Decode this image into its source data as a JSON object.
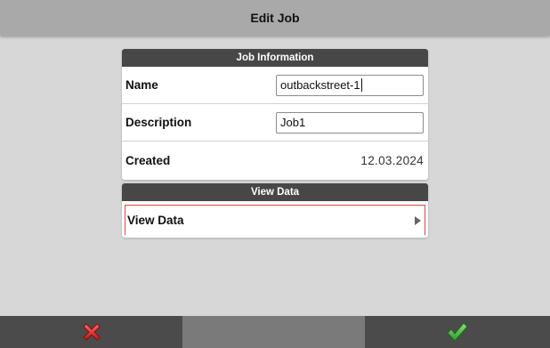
{
  "header": {
    "title": "Edit Job"
  },
  "job_information": {
    "section_title": "Job Information",
    "name_label": "Name",
    "name_value": "outbackstreet-1",
    "description_label": "Description",
    "description_value": "Job1",
    "created_label": "Created",
    "created_value": "12.03.2024"
  },
  "view_data": {
    "section_title": "View Data",
    "item_label": "View Data"
  },
  "bottom_bar": {
    "cancel_icon": "red-x-icon",
    "confirm_icon": "green-checkmark-icon"
  },
  "colors": {
    "background": "#d7d7d7",
    "titlebar": "#a9a9a9",
    "section_header": "#474747",
    "selected_outline": "#e04848",
    "cancel": "#e02a2a",
    "confirm": "#4caf50"
  }
}
